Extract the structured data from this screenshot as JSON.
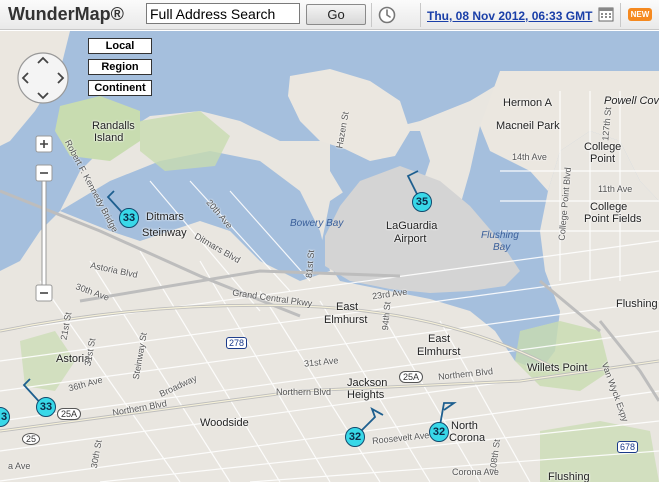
{
  "toolbar": {
    "title": "WunderMap®",
    "search_value": "Full Address Search",
    "go_label": "Go",
    "date": "Thu, 08 Nov 2012, 06:33 GMT",
    "new_badge": "NEW"
  },
  "map_controls": {
    "zoom_local": "Local",
    "zoom_region": "Region",
    "zoom_continent": "Continent"
  },
  "map_labels": {
    "randalls": "Randalls",
    "island": "Island",
    "hermon": "Hermon A",
    "macneil": "Macneil Park",
    "powell": "Powell Cove",
    "college_point": "College",
    "point": "Point",
    "college_point_fields": "College",
    "point_fields": "Point Fields",
    "ditmars": "Ditmars",
    "steinway": "Steinway",
    "bowery_bay": "Bowery Bay",
    "laguardia": "LaGuardia",
    "airport": "Airport",
    "flushing_bay": "Flushing",
    "bay": "Bay",
    "astoria": "Astoria",
    "east_elmhurst_1": "East",
    "east_elmhurst_2": "Elmhurst",
    "east_elmhurst_b1": "East",
    "east_elmhurst_b2": "Elmhurst",
    "jackson": "Jackson",
    "heights": "Heights",
    "woodside": "Woodside",
    "north_corona_1": "North",
    "north_corona_2": "Corona",
    "flushing_ne": "Flushing",
    "flushing_s": "Flushing",
    "willets_point": "Willets Point",
    "grand_central": "Grand Central Pkwy",
    "northern_blvd": "Northern Blvd",
    "northern_blvd_2": "Northern Blvd",
    "northern_blvd_3": "Northern Blvd",
    "astoria_blvd": "Astoria Blvd",
    "ditmars_blvd": "Ditmars Blvd",
    "roosevelt_ave": "Roosevelt Ave",
    "broadway": "Broadway",
    "rfk_bridge": "Robert F. Kennedy Bridge",
    "hazen_st": "Hazen St",
    "st_14th": "14th Ave",
    "st_11th": "11th Ave",
    "st_20th": "20th Ave",
    "st_23rd": "23rd Ave",
    "st_31st": "31st Ave",
    "st_30th": "30th Ave",
    "st_36th": "36th Ave",
    "st_81st": "81st St",
    "st_94th": "94th St",
    "st_108th": "108th St",
    "st_127th": "127th St",
    "st_steinway": "Steinway St",
    "st_21st": "21st St",
    "st_31st_st": "31st St",
    "st_30th_st": "30th St",
    "st_college_point": "College Point Blvd",
    "st_van_wyck": "Van Wyck Expy",
    "st_corona_ave": "Corona Ave",
    "st_a_ave": "a Ave",
    "route_25a_1": "25A",
    "route_25a_2": "25A",
    "route_25": "25",
    "route_278": "278",
    "route_678": "678"
  },
  "stations": [
    {
      "value": "33"
    },
    {
      "value": "35"
    },
    {
      "value": "33"
    },
    {
      "value": "32"
    },
    {
      "value": "32"
    },
    {
      "value": "3"
    }
  ]
}
